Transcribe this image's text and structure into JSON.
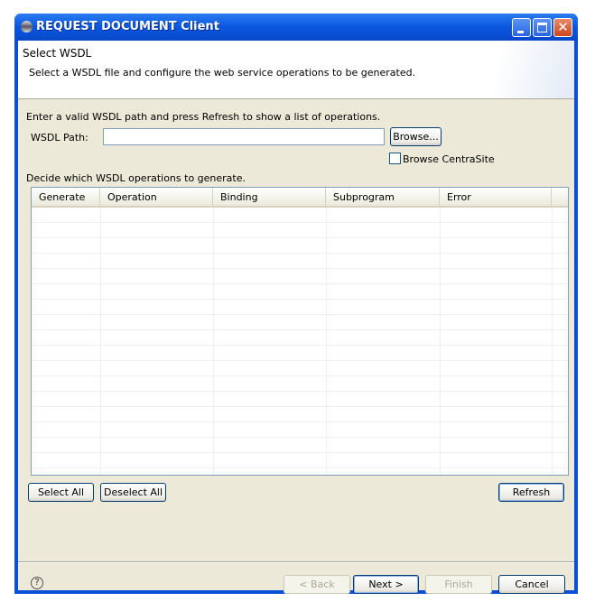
{
  "window": {
    "title": "REQUEST DOCUMENT Client"
  },
  "header": {
    "title": "Select WSDL",
    "description": "Select a WSDL file and configure the web service operations to be generated."
  },
  "form": {
    "instruction": "Enter a valid WSDL path and press Refresh to show a list of operations.",
    "wsdl_label": "WSDL Path:",
    "wsdl_value": "",
    "browse_label": "Browse...",
    "centrasite_label": "Browse CentraSite",
    "centrasite_checked": false,
    "decide_label": "Decide which WSDL operations to generate."
  },
  "table": {
    "columns": [
      "Generate",
      "Operation",
      "Binding",
      "Subprogram",
      "Error"
    ],
    "rows": []
  },
  "actions": {
    "select_all": "Select All",
    "deselect_all": "Deselect All",
    "refresh": "Refresh"
  },
  "footer": {
    "back": "< Back",
    "next": "Next >",
    "finish": "Finish",
    "cancel": "Cancel",
    "help_icon": "question-icon"
  }
}
